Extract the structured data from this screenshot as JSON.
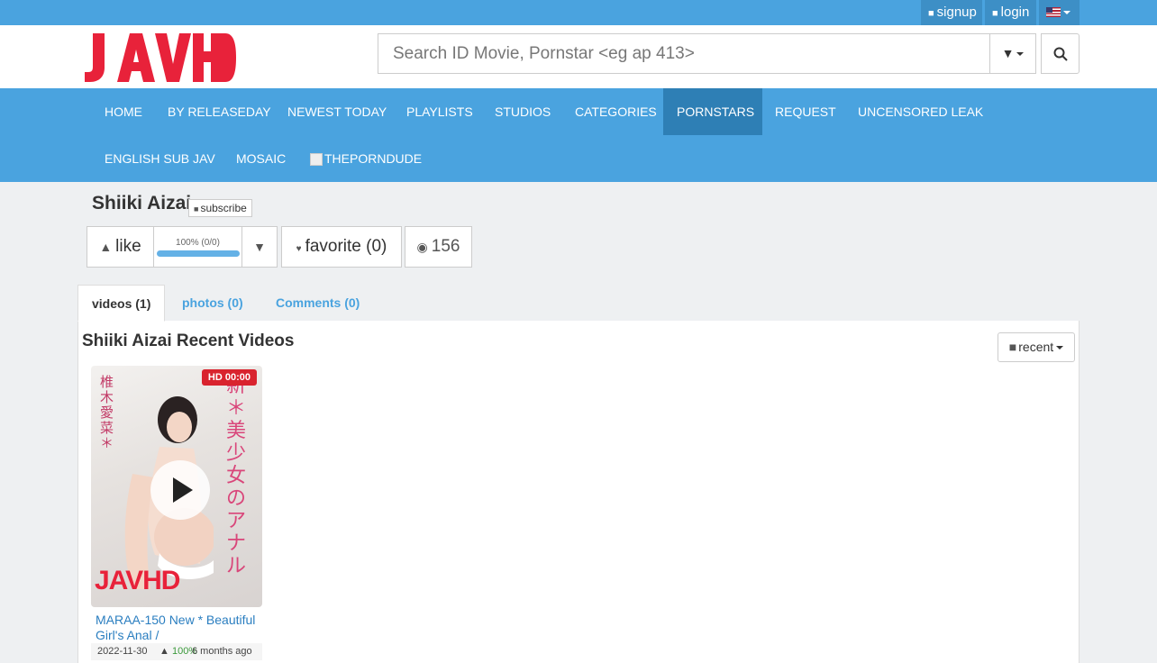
{
  "topbar": {
    "signup_icon": "user-plus-icon",
    "signup_label": "signup",
    "login_icon": "sign-in-icon",
    "login_label": "login",
    "language": "en-US-flag"
  },
  "header": {
    "logo_text": "JAVHD",
    "search_placeholder": "Search ID Movie, Pornstar <eg ap 413>",
    "filter_icon": "filter-icon",
    "search_icon": "search-icon"
  },
  "nav": {
    "items": [
      {
        "label": "HOME"
      },
      {
        "label": "BY RELEASEDAY"
      },
      {
        "label": "NEWEST TODAY"
      },
      {
        "label": "PLAYLISTS"
      },
      {
        "label": "STUDIOS"
      },
      {
        "label": "CATEGORIES"
      },
      {
        "label": "PORNSTARS"
      },
      {
        "label": "REQUEST"
      },
      {
        "label": "UNCENSORED LEAK"
      },
      {
        "label": "ENGLISH SUB JAV"
      },
      {
        "label": "MOSAIC"
      },
      {
        "label": "THEPORNDUDE"
      }
    ],
    "active": "PORNSTARS"
  },
  "profile": {
    "name": "Shiiki Aizai",
    "subscribe_label": "subscribe",
    "like_label": "like",
    "rating_text": "100% (0/0)",
    "rating_fraction": 1.0,
    "favorite_label": "favorite (0)",
    "views": "156"
  },
  "tabs": [
    {
      "label": "videos (1)",
      "active": true
    },
    {
      "label": "photos (0)",
      "active": false
    },
    {
      "label": "Comments (0)",
      "active": false
    }
  ],
  "section": {
    "title": "Shiiki Aizai Recent Videos",
    "sort_label": "recent"
  },
  "videos": [
    {
      "badge": "HD 00:00",
      "cover_text_right": "新＊美少女のアナル",
      "cover_text_left": "椎木愛菜＊",
      "watermark": "JAVHD",
      "title": "MARAA-150 New * Beautiful Girl's Anal /",
      "date": "2022-11-30",
      "rating": "100%",
      "ago": "6 months ago"
    }
  ],
  "colors": {
    "nav_bg": "#4aa3df",
    "nav_active": "#2e7fb5",
    "link": "#2a7ec0",
    "badge": "#d9232e",
    "logo": "#e8223a"
  }
}
